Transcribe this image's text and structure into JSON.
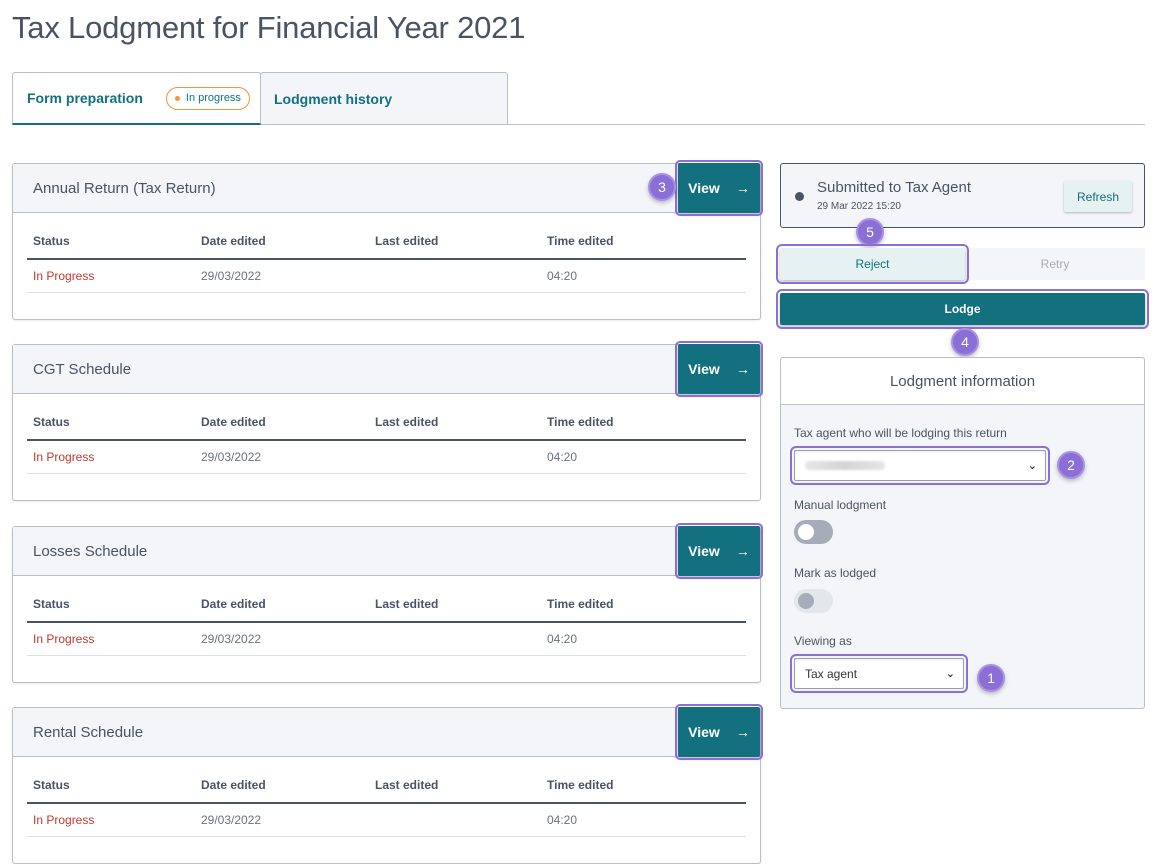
{
  "page_title": "Tax Lodgment for Financial Year 2021",
  "tabs": [
    {
      "label": "Form preparation",
      "badge": "In progress",
      "active": true
    },
    {
      "label": "Lodgment history",
      "active": false
    }
  ],
  "forms": [
    {
      "title": "Annual Return (Tax Return)",
      "view_label": "View",
      "view_icon": "arrow-right-icon",
      "callout": "3",
      "columns": [
        "Status",
        "Date edited",
        "Last edited",
        "Time edited"
      ],
      "rows": [
        {
          "status": "In Progress",
          "date_edited": "29/03/2022",
          "last_edited": "",
          "time_edited": "04:20"
        }
      ]
    },
    {
      "title": "CGT Schedule",
      "view_label": "View",
      "view_icon": "arrow-right-icon",
      "columns": [
        "Status",
        "Date edited",
        "Last edited",
        "Time edited"
      ],
      "rows": [
        {
          "status": "In Progress",
          "date_edited": "29/03/2022",
          "last_edited": "",
          "time_edited": "04:20"
        }
      ]
    },
    {
      "title": "Losses Schedule",
      "view_label": "View",
      "view_icon": "arrow-right-icon",
      "columns": [
        "Status",
        "Date edited",
        "Last edited",
        "Time edited"
      ],
      "rows": [
        {
          "status": "In Progress",
          "date_edited": "29/03/2022",
          "last_edited": "",
          "time_edited": "04:20"
        }
      ]
    },
    {
      "title": "Rental Schedule",
      "view_label": "View",
      "view_icon": "arrow-right-icon",
      "columns": [
        "Status",
        "Date edited",
        "Last edited",
        "Time edited"
      ],
      "rows": [
        {
          "status": "In Progress",
          "date_edited": "29/03/2022",
          "last_edited": "",
          "time_edited": "04:20"
        }
      ]
    }
  ],
  "status": {
    "title": "Submitted to Tax Agent",
    "timestamp": "29 Mar 2022 15:20",
    "refresh_label": "Refresh"
  },
  "actions": {
    "reject_label": "Reject",
    "retry_label": "Retry",
    "lodge_label": "Lodge",
    "reject_callout": "5",
    "lodge_callout": "4"
  },
  "lodgment_info": {
    "title": "Lodgment information",
    "tax_agent_label": "Tax agent who will be lodging this return",
    "tax_agent_value": "",
    "tax_agent_callout": "2",
    "manual_lodgment_label": "Manual lodgment",
    "manual_lodgment_on": false,
    "mark_as_lodged_label": "Mark as lodged",
    "mark_as_lodged_on": false,
    "viewing_as_label": "Viewing as",
    "viewing_as_value": "Tax agent",
    "viewing_as_callout": "1"
  },
  "colors": {
    "primary": "#12707f",
    "accent_outline": "#8b6fd6",
    "status_in_progress": "#c0392b",
    "badge_orange": "#f0963c"
  }
}
